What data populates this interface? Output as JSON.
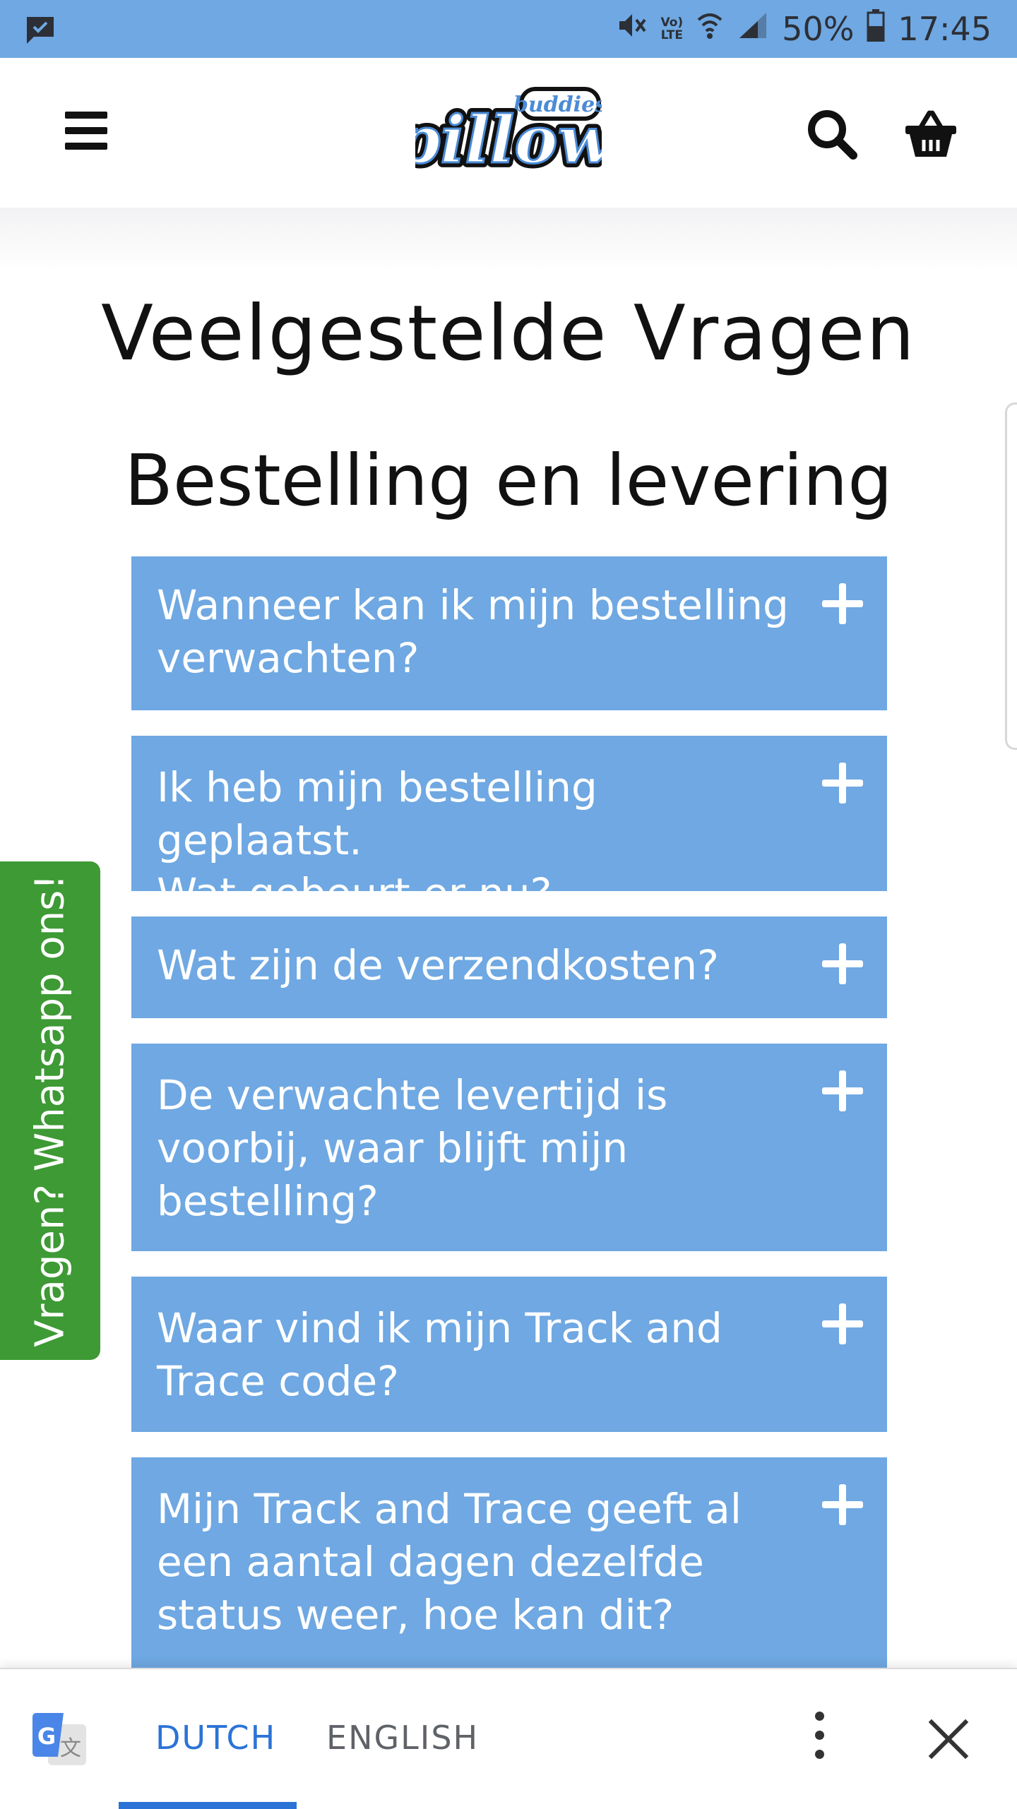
{
  "status_bar": {
    "volte_line1": "Vo)",
    "volte_line2": "LTE",
    "battery": "50%",
    "time": "17:45",
    "background": "#6fa8e2"
  },
  "header": {
    "logo_small": "buddies",
    "logo_main": "pillow",
    "icons": [
      "menu-icon",
      "search-icon",
      "basket-icon"
    ]
  },
  "page": {
    "title": "Veelgestelde Vragen",
    "section_title": "Bestelling en levering"
  },
  "faq": {
    "items": [
      {
        "lines": [
          "Wanneer kan ik mijn bestelling",
          "verwachten?"
        ]
      },
      {
        "lines": [
          "Ik heb mijn bestelling geplaatst.",
          "Wat gebeurt er nu?"
        ]
      },
      {
        "lines": [
          "Wat zijn de verzendkosten?"
        ]
      },
      {
        "lines": [
          "De verwachte levertijd is",
          "voorbij, waar blijft mijn",
          "bestelling?"
        ]
      },
      {
        "lines": [
          "Waar vind ik mijn Track and",
          "Trace code?"
        ]
      },
      {
        "lines": [
          "Mijn Track and Trace geeft al",
          "een aantal dagen dezelfde",
          "status weer, hoe kan dit?"
        ]
      }
    ],
    "accent": "#6fa8e2"
  },
  "whatsapp": {
    "label": "Vragen? Whatsapp ons!",
    "color": "#3d9a34"
  },
  "translate_bar": {
    "tab_active": "DUTCH",
    "tab_inactive": "ENGLISH",
    "active_color": "#2b73d6"
  }
}
